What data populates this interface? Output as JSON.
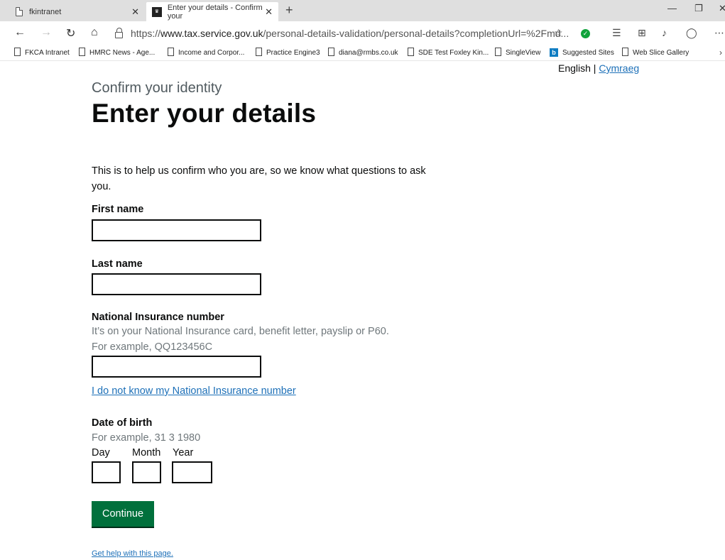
{
  "browser": {
    "tabs": [
      {
        "title": "fkintranet"
      },
      {
        "title": "Enter your details - Confirm your"
      }
    ],
    "url": {
      "scheme": "https://",
      "host": "www.tax.service.gov.uk",
      "path": "/personal-details-validation/personal-details?completionUrl=%2Fmd..."
    },
    "favorites": [
      "FKCA Intranet",
      "HMRC News - Age...",
      "Income and Corpor...",
      "Practice Engine3",
      "diana@rmbs.co.uk",
      "SDE Test Foxley Kin...",
      "SingleView",
      "Suggested Sites",
      "Web Slice Gallery"
    ]
  },
  "language": {
    "current": "English",
    "separator": " | ",
    "alternate": "Cymraeg"
  },
  "page": {
    "caption": "Confirm your identity",
    "heading": "Enter your details",
    "intro": "This is to help us confirm who you are, so we know what questions to ask you."
  },
  "form": {
    "first_name": {
      "label": "First name",
      "value": ""
    },
    "last_name": {
      "label": "Last name",
      "value": ""
    },
    "nino": {
      "label": "National Insurance number",
      "hint1": "It’s on your National Insurance card, benefit letter, payslip or P60.",
      "hint2": "For example, QQ123456C",
      "value": ""
    },
    "nino_link": "I do not know my National Insurance number",
    "dob": {
      "label": "Date of birth",
      "hint": "For example, 31 3 1980",
      "day_label": "Day",
      "month_label": "Month",
      "year_label": "Year"
    },
    "continue_label": "Continue",
    "help_link": "Get help with this page."
  }
}
